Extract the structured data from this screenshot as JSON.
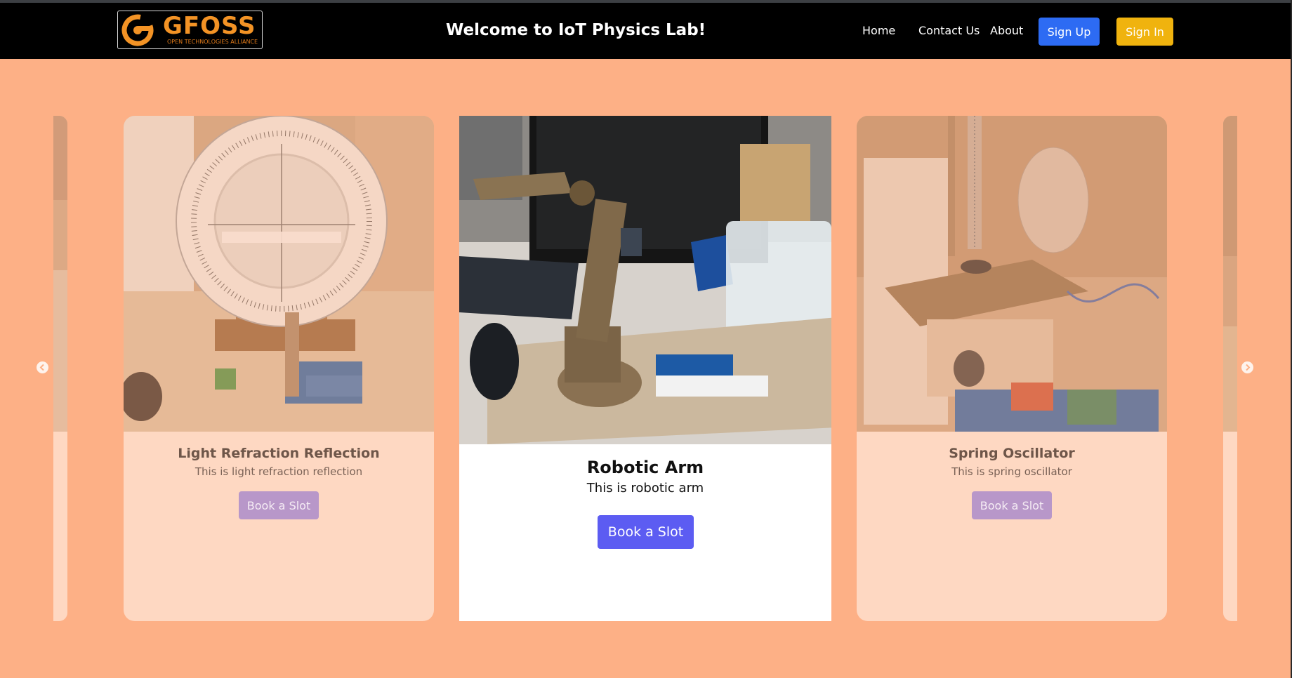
{
  "navbar": {
    "logo": {
      "text": "GFOSS",
      "subtext": "OPEN TECHNOLOGIES ALLIANCE",
      "icon": "gfoss-logo-icon"
    },
    "title": "Welcome to IoT Physics Lab!",
    "links": [
      "Home",
      "Contact Us",
      "About"
    ],
    "signup_label": "Sign Up",
    "signin_label": "Sign In"
  },
  "carousel": {
    "prev_icon": "chevron-left-icon",
    "next_icon": "chevron-right-icon",
    "cards": [
      {
        "title": "Light Refraction Reflection",
        "description": "This is light refraction reflection",
        "button": "Book a Slot",
        "image": "protractor-optics-apparatus-photo"
      },
      {
        "title": "Robotic Arm",
        "description": "This is robotic arm",
        "button": "Book a Slot",
        "image": "robotic-arm-arduino-photo"
      },
      {
        "title": "Spring Oscillator",
        "description": "This is spring oscillator",
        "button": "Book a Slot",
        "image": "spring-oscillator-apparatus-photo"
      }
    ]
  },
  "colors": {
    "navbar_bg": "#000000",
    "page_bg": "#fdb086",
    "logo_orange": "#f39325",
    "signup_blue": "#2d6bf3",
    "signin_yellow": "#f0b30e",
    "center_button": "#5c5cf2",
    "side_button": "#b897c9"
  }
}
